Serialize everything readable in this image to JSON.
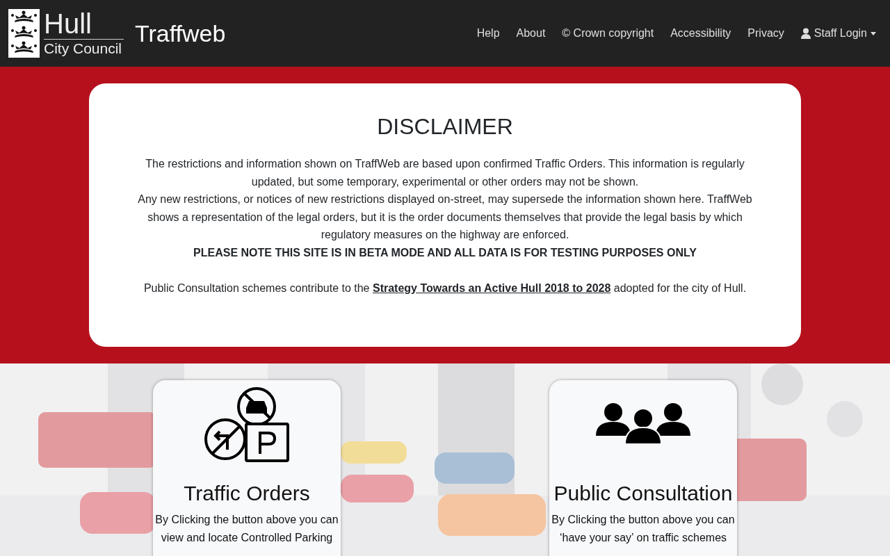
{
  "header": {
    "logo": {
      "name": "Hull",
      "subtitle": "City Council"
    },
    "title": "Traffweb",
    "nav": [
      {
        "label": "Help",
        "kind": "link"
      },
      {
        "label": "About",
        "kind": "link"
      },
      {
        "label": "© Crown copyright",
        "kind": "link"
      },
      {
        "label": "Accessibility",
        "kind": "link"
      },
      {
        "label": "Privacy",
        "kind": "link"
      },
      {
        "label": "Staff Login",
        "kind": "dropdown"
      }
    ]
  },
  "disclaimer": {
    "heading": "DISCLAIMER",
    "paragraphs": [
      "The restrictions and information shown on TraffWeb are based upon confirmed Traffic Orders. This information is regularly updated, but some temporary, experimental or other orders may not be shown.",
      "Any new restrictions, or notices of new restrictions displayed on-street, may supersede the information shown here. TraffWeb shows a representation of the legal orders, but it is the order documents themselves that provide the legal basis by which regulatory measures on the highway are enforced."
    ],
    "notice": "PLEASE NOTE THIS SITE IS IN BETA MODE AND ALL DATA IS FOR TESTING PURPOSES ONLY",
    "consultation": {
      "before": "Public Consultation schemes contribute to the",
      "link": "Strategy Towards an Active Hull 2018 to 2028",
      "after": "adopted for the city of Hull."
    }
  },
  "cards": [
    {
      "kind": "orders",
      "title": "Traffic Orders",
      "lines": [
        "By Clicking the button above you can",
        "view and locate Controlled Parking"
      ]
    },
    {
      "kind": "consultation",
      "title": "Public Consultation",
      "lines": [
        "By Clicking the button above you can",
        "‘have your say’ on traffic schemes"
      ]
    }
  ]
}
